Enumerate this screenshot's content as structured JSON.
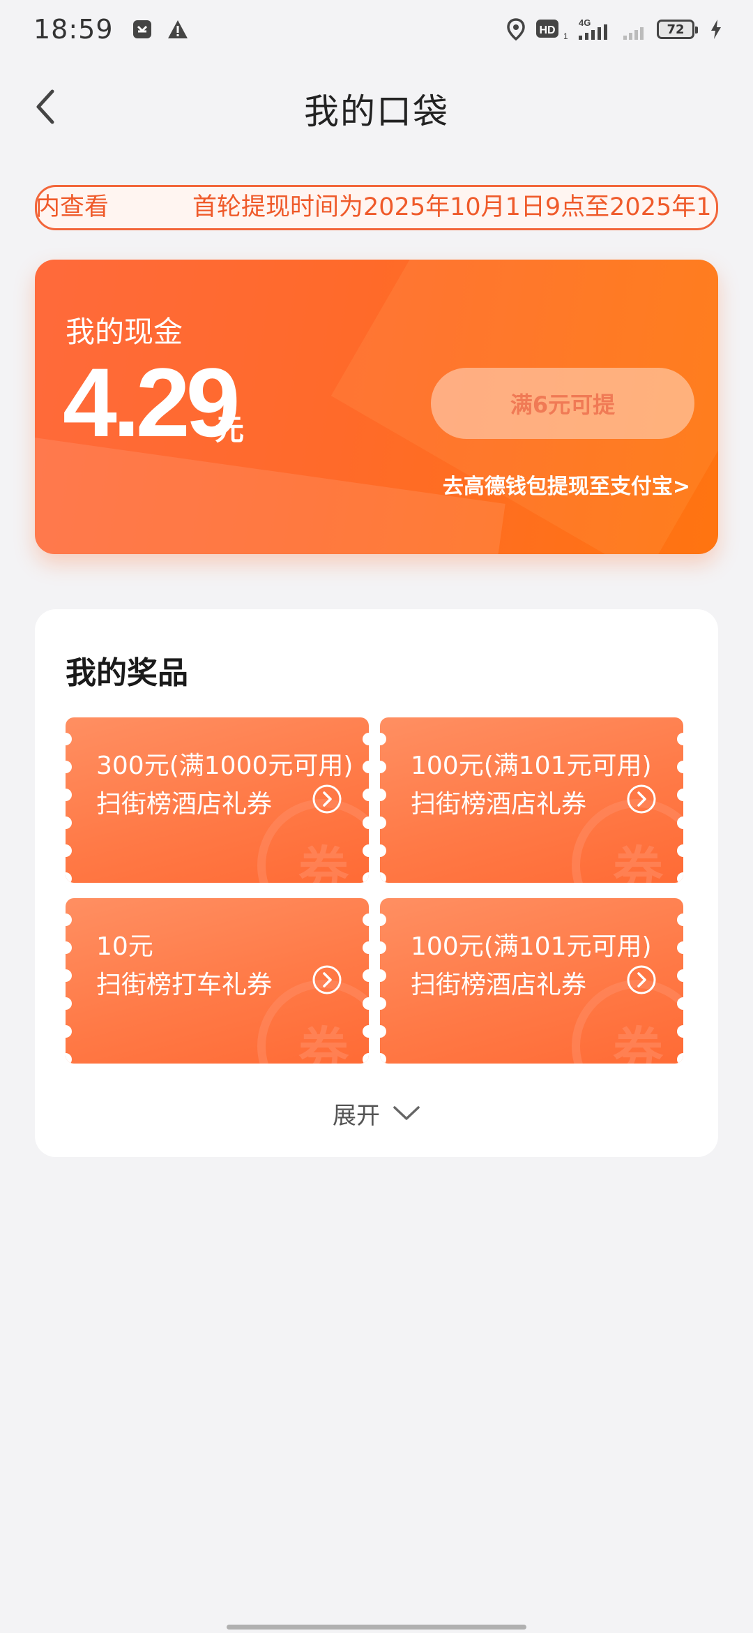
{
  "status_bar": {
    "time": "18:59",
    "battery_level": "72",
    "network": "4G",
    "hd_badge": "HD",
    "sim_index": "1",
    "icons": [
      "app-icon",
      "warning-icon",
      "location-icon",
      "hd-icon",
      "signal-4g-icon",
      "signal-icon",
      "battery-icon",
      "charging-icon"
    ]
  },
  "nav": {
    "title": "我的口袋",
    "back_icon": "chevron-left-icon"
  },
  "notice": {
    "text_a": "内查看",
    "text_b": "首轮提现时间为2025年10月1日9点至2025年1"
  },
  "cash": {
    "label": "我的现金",
    "amount": "4.29",
    "unit": "元",
    "withdraw_button": "满6元可提",
    "wallet_link": "去高德钱包提现至支付宝>"
  },
  "prizes": {
    "title": "我的奖品",
    "coupons": [
      {
        "line1": "300元(满1000元可用)",
        "line2": "扫街榜酒店礼券",
        "seal": "券"
      },
      {
        "line1": "100元(满101元可用)",
        "line2": "扫街榜酒店礼券",
        "seal": "券"
      },
      {
        "line1": "10元",
        "line2": "扫街榜打车礼券",
        "seal": "券"
      },
      {
        "line1": "100元(满101元可用)",
        "line2": "扫街榜酒店礼券",
        "seal": "券"
      }
    ],
    "expand_label": "展开"
  },
  "colors": {
    "accent": "#ff6a2a",
    "notice_text": "#ef5a2a",
    "coupon_bg": "#ff7a47",
    "page_bg": "#f3f3f5"
  }
}
